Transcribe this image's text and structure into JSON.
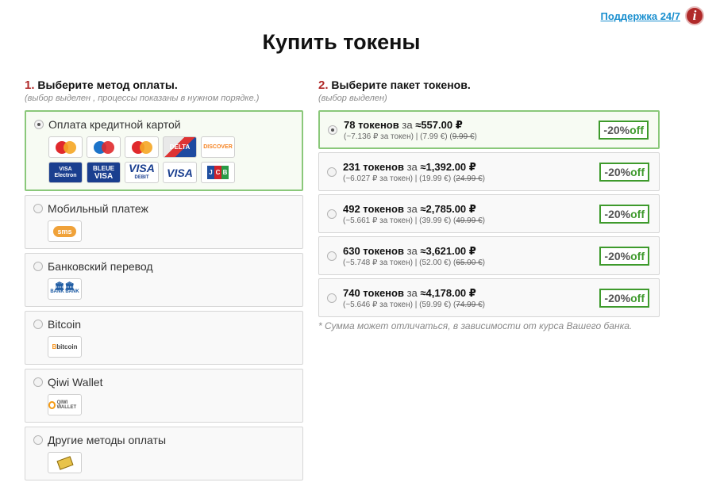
{
  "support": {
    "label": "Поддержка 24/7",
    "icon": "info-icon",
    "icon_glyph": "i"
  },
  "title": "Купить токены",
  "step1": {
    "num": "1.",
    "title": "Выберите метод оплаты.",
    "subtitle": "(выбор выделен , процессы показаны в нужном порядке.)"
  },
  "step2": {
    "num": "2.",
    "title": "Выберите пакет токенов.",
    "subtitle": "(выбор выделен)"
  },
  "methods": [
    {
      "label": "Оплата кредитной картой",
      "selected": true
    },
    {
      "label": "Мобильный платеж",
      "selected": false,
      "logo_text": "sms"
    },
    {
      "label": "Банковский перевод",
      "selected": false,
      "logo_text": "BANK BANK"
    },
    {
      "label": "Bitcoin",
      "selected": false,
      "logo_text": "bitcoin"
    },
    {
      "label": "Qiwi Wallet",
      "selected": false,
      "logo_text": "QIWI WALLET"
    },
    {
      "label": "Другие методы оплаты",
      "selected": false
    }
  ],
  "card_logos": {
    "mastercard": "MasterCard",
    "maestro": "Maestro",
    "mcdebit": "Debit",
    "delta": "DELTA",
    "discover": "DISCOVER",
    "visa_electron_1": "VISA",
    "visa_electron_2": "Electron",
    "bleue_1": "BLEUE",
    "bleue_2": "VISA",
    "visa_debit_1": "VISA",
    "visa_debit_2": "DEBIT",
    "visa": "VISA",
    "jcb": [
      "J",
      "C",
      "B"
    ]
  },
  "za": "за",
  "packages": [
    {
      "tokens": "78 токенов",
      "price": "≈557.00 ₽",
      "per": "(~7.136 ₽ за токен)",
      "eur": "(7.99 €)",
      "old": "9.99 €",
      "badge_pct": "-20%",
      "badge_off": "off",
      "selected": true
    },
    {
      "tokens": "231 токенов",
      "price": "≈1,392.00 ₽",
      "per": "(~6.027 ₽ за токен)",
      "eur": "(19.99 €)",
      "old": "24.99 €",
      "badge_pct": "-20%",
      "badge_off": "off",
      "selected": false
    },
    {
      "tokens": "492 токенов",
      "price": "≈2,785.00 ₽",
      "per": "(~5.661 ₽ за токен)",
      "eur": "(39.99 €)",
      "old": "49.99 €",
      "badge_pct": "-20%",
      "badge_off": "off",
      "selected": false
    },
    {
      "tokens": "630 токенов",
      "price": "≈3,621.00 ₽",
      "per": "(~5.748 ₽ за токен)",
      "eur": "(52.00 €)",
      "old": "65.00 €",
      "badge_pct": "-20%",
      "badge_off": "off",
      "selected": false
    },
    {
      "tokens": "740 токенов",
      "price": "≈4,178.00 ₽",
      "per": "(~5.646 ₽ за токен)",
      "eur": "(59.99 €)",
      "old": "74.99 €",
      "badge_pct": "-20%",
      "badge_off": "off",
      "selected": false
    }
  ],
  "separator": "|",
  "note": "* Сумма может отличаться, в зависимости от курса Вашего банка.",
  "colors": {
    "accent_red": "#b02a2a",
    "link_blue": "#1a8fcf",
    "selected_border": "#8ac87a",
    "badge_green": "#3e9a2c"
  }
}
